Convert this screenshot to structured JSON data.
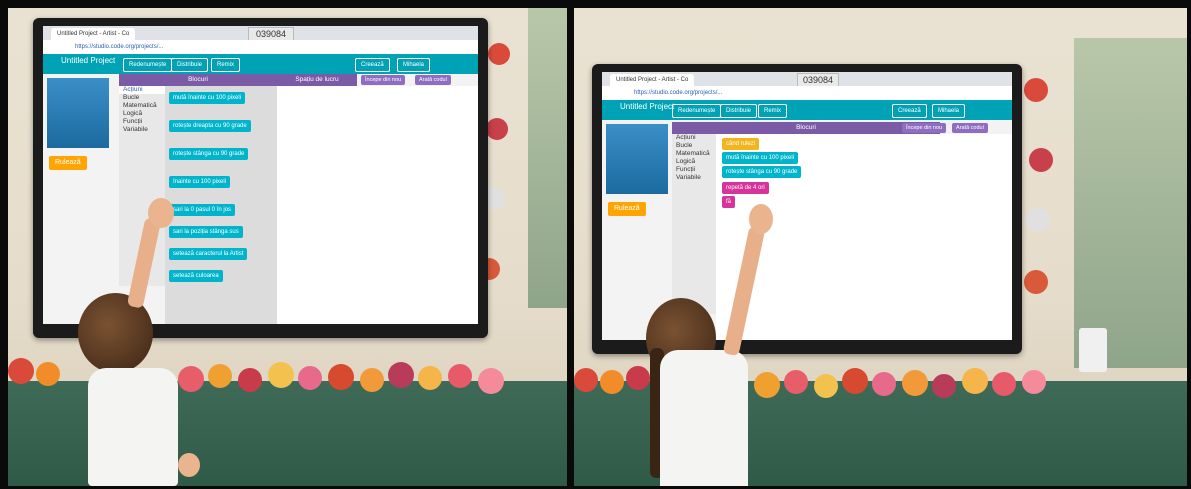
{
  "photo_left": {
    "screen": {
      "tab_title": "Untitled Project - Artist - Co",
      "room_code": "039084",
      "url": "https://studio.code.org/projects/...",
      "project_title": "Untitled Project",
      "project_subtitle": "Salvat 0 ore în urmă",
      "header_buttons": [
        "Redenumește",
        "Distribuie",
        "Remix"
      ],
      "header_right": [
        "Creează",
        "Mihaela"
      ],
      "run_label": "Rulează",
      "panel_title": "Blocuri",
      "workspace_title": "Spațiu de lucru",
      "workspace_buttons": [
        "Începe din nou",
        "Arată codul"
      ],
      "categories": [
        "Acțiuni",
        "Bucle",
        "Matematică",
        "Logică",
        "Funcții",
        "Variabile"
      ],
      "blocks": [
        "mută înainte cu 100 pixeli",
        "rotește dreapta cu 90 grade",
        "rotește stânga cu 90 grade",
        "înainte cu 100 pixeli",
        "sari la 0 pasul 0 în jos",
        "sari la poziția stânga sus",
        "setează caracterul la Artist",
        "setează culoarea"
      ]
    }
  },
  "photo_right": {
    "screen": {
      "tab_title": "Untitled Project - Artist - Co",
      "room_code": "039084",
      "url": "https://studio.code.org/projects/...",
      "project_title": "Untitled Project",
      "project_subtitle": "Salvat 0 ore în urmă",
      "header_buttons": [
        "Redenumește",
        "Distribuie",
        "Remix"
      ],
      "header_right": [
        "Creează",
        "Mihaela"
      ],
      "run_label": "Rulează",
      "panel_title": "Blocuri",
      "workspace_buttons": [
        "Începe din nou",
        "Arată codul"
      ],
      "categories": [
        "Acțiuni",
        "Bucle",
        "Matematică",
        "Logică",
        "Funcții",
        "Variabile"
      ],
      "blocks": [
        "când rulezi",
        "mută înainte cu 100 pixeli",
        "rotește stânga cu 90 grade",
        "repetă de 4 ori",
        "fă"
      ]
    }
  },
  "colors": {
    "codeorg_header": "#00a3b6",
    "block_teal": "#00b4cc",
    "block_pink": "#d6339b",
    "block_yellow": "#f2b51d",
    "panel_purple": "#7b5aa6",
    "run_orange": "#ffa400"
  }
}
